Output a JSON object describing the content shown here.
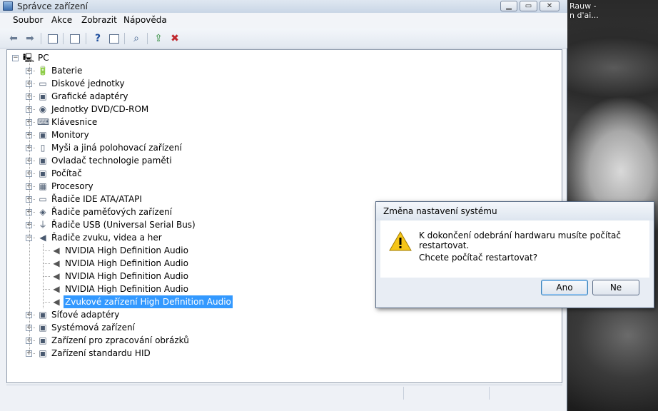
{
  "window": {
    "title": "Správce zařízení"
  },
  "desktop": {
    "text": "Rauw -\nn d'ai..."
  },
  "menu": [
    "Soubor",
    "Akce",
    "Zobrazit",
    "Nápověda"
  ],
  "toolbar": {
    "icons": [
      "back-arrow-icon",
      "forward-arrow-icon",
      "tree-view-icon",
      "properties-icon",
      "help-icon",
      "detail-view-icon",
      "scan-hardware-icon",
      "update-driver-icon",
      "uninstall-device-icon"
    ]
  },
  "tree": {
    "root": "PC",
    "categories": [
      {
        "label": "Baterie",
        "icon": "battery-icon",
        "glyph": "🔋"
      },
      {
        "label": "Diskové jednotky",
        "icon": "disk-drive-icon",
        "glyph": "▭"
      },
      {
        "label": "Grafické adaptéry",
        "icon": "display-adapter-icon",
        "glyph": "▣"
      },
      {
        "label": "Jednotky DVD/CD-ROM",
        "icon": "dvd-drive-icon",
        "glyph": "◉"
      },
      {
        "label": "Klávesnice",
        "icon": "keyboard-icon",
        "glyph": "⌨"
      },
      {
        "label": "Monitory",
        "icon": "monitor-icon",
        "glyph": "▣"
      },
      {
        "label": "Myši a jiná polohovací zařízení",
        "icon": "mouse-icon",
        "glyph": "▯"
      },
      {
        "label": "Ovladač technologie paměti",
        "icon": "memory-controller-icon",
        "glyph": "▣"
      },
      {
        "label": "Počítač",
        "icon": "computer-icon",
        "glyph": "▣"
      },
      {
        "label": "Procesory",
        "icon": "processor-icon",
        "glyph": "▦"
      },
      {
        "label": "Řadiče IDE ATA/ATAPI",
        "icon": "ide-controller-icon",
        "glyph": "▭"
      },
      {
        "label": "Řadiče paměťových zařízení",
        "icon": "storage-controller-icon",
        "glyph": "◈"
      },
      {
        "label": "Řadiče USB (Universal Serial Bus)",
        "icon": "usb-icon",
        "glyph": "⏚"
      },
      {
        "label": "Řadiče zvuku, videa a her",
        "icon": "speaker-icon",
        "glyph": "◀",
        "expanded": true,
        "children": [
          {
            "label": "NVIDIA High Definition Audio",
            "icon": "speaker-icon"
          },
          {
            "label": "NVIDIA High Definition Audio",
            "icon": "speaker-icon"
          },
          {
            "label": "NVIDIA High Definition Audio",
            "icon": "speaker-icon"
          },
          {
            "label": "NVIDIA High Definition Audio",
            "icon": "speaker-icon"
          },
          {
            "label": "Zvukové zařízení High Definition Audio",
            "icon": "speaker-icon",
            "selected": true
          }
        ]
      },
      {
        "label": "Síťové adaptéry",
        "icon": "network-adapter-icon",
        "glyph": "▣"
      },
      {
        "label": "Systémová zařízení",
        "icon": "system-device-icon",
        "glyph": "▣"
      },
      {
        "label": "Zařízení pro zpracování obrázků",
        "icon": "imaging-device-icon",
        "glyph": "▣"
      },
      {
        "label": "Zařízení standardu HID",
        "icon": "hid-device-icon",
        "glyph": "▣"
      }
    ]
  },
  "dialog": {
    "title": "Změna nastavení systému",
    "message": "K dokončení odebrání hardwaru musíte počítač restartovat.",
    "question": "Chcete počítač restartovat?",
    "yes_label": "Ano",
    "no_label": "Ne"
  },
  "colors": {
    "selection": "#3399ff",
    "window_bg": "#eef1f6"
  }
}
